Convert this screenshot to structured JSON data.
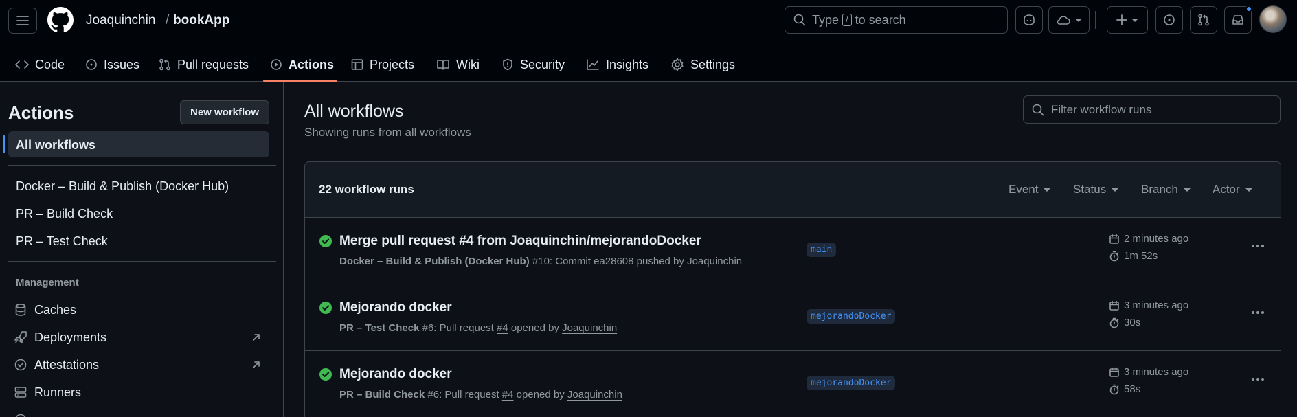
{
  "header": {
    "owner": "Joaquinchin",
    "separator": "/",
    "repo": "bookApp",
    "search": {
      "prefix": "Type",
      "key": "/",
      "suffix": "to search"
    }
  },
  "tabs": [
    {
      "label": "Code",
      "icon": "code-icon"
    },
    {
      "label": "Issues",
      "icon": "issue-icon"
    },
    {
      "label": "Pull requests",
      "icon": "pull-request-icon"
    },
    {
      "label": "Actions",
      "icon": "play-icon",
      "active": true
    },
    {
      "label": "Projects",
      "icon": "table-icon"
    },
    {
      "label": "Wiki",
      "icon": "book-icon"
    },
    {
      "label": "Security",
      "icon": "shield-icon"
    },
    {
      "label": "Insights",
      "icon": "graph-icon"
    },
    {
      "label": "Settings",
      "icon": "gear-icon"
    }
  ],
  "sidebar": {
    "title": "Actions",
    "new_workflow": "New workflow",
    "selected": "All workflows",
    "workflows": [
      "Docker – Build & Publish (Docker Hub)",
      "PR – Build Check",
      "PR – Test Check"
    ],
    "management_label": "Management",
    "management": [
      {
        "label": "Caches",
        "icon": "database-icon"
      },
      {
        "label": "Deployments",
        "icon": "rocket-icon",
        "external": true
      },
      {
        "label": "Attestations",
        "icon": "verified-icon",
        "external": true
      },
      {
        "label": "Runners",
        "icon": "server-icon"
      }
    ]
  },
  "main": {
    "title": "All workflows",
    "subtitle": "Showing runs from all workflows",
    "filter_placeholder": "Filter workflow runs",
    "count": "22 workflow runs",
    "filters": [
      "Event",
      "Status",
      "Branch",
      "Actor"
    ],
    "runs": [
      {
        "title": "Merge pull request #4 from Joaquinchin/mejorandoDocker",
        "workflow": "Docker – Build & Publish (Docker Hub)",
        "number": "#10",
        "event_text": ": Commit",
        "ref": "ea28608",
        "verb": "pushed by",
        "actor": "Joaquinchin",
        "branch": "main",
        "when": "2 minutes ago",
        "duration": "1m 52s",
        "status": "success"
      },
      {
        "title": "Mejorando docker",
        "workflow": "PR – Test Check",
        "number": "#6",
        "event_text": ": Pull request",
        "ref": "#4",
        "verb": "opened by",
        "actor": "Joaquinchin",
        "branch": "mejorandoDocker",
        "when": "3 minutes ago",
        "duration": "30s",
        "status": "success"
      },
      {
        "title": "Mejorando docker",
        "workflow": "PR – Build Check",
        "number": "#6",
        "event_text": ": Pull request",
        "ref": "#4",
        "verb": "opened by",
        "actor": "Joaquinchin",
        "branch": "mejorandoDocker",
        "when": "3 minutes ago",
        "duration": "58s",
        "status": "success"
      }
    ]
  },
  "colors": {
    "accent": "#f78166",
    "success": "#3fb950",
    "link": "#4493f8",
    "bg": "#0d1117"
  }
}
